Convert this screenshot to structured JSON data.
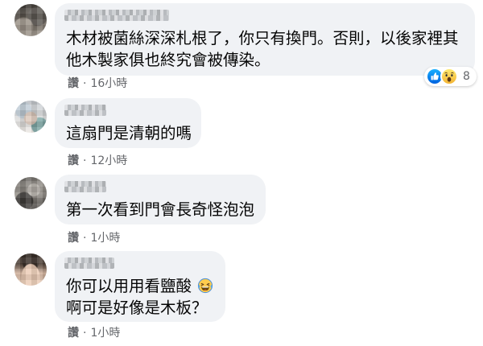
{
  "colors": {
    "page_background": "#ffffff",
    "bubble_background": "#f0f2f5",
    "text_primary": "#050505",
    "text_secondary": "#65676b",
    "like_blue": "#1877f2",
    "wow_yellow": "#f7c94f"
  },
  "comments": [
    {
      "text_lines": [
        "木材被菌絲深深札根了，你只有換門。否則，以後家裡其",
        "他木製家俱也終究會被傳染。"
      ],
      "actions": {
        "like": "讚",
        "separator": "·",
        "time": "16小時"
      },
      "reactions": {
        "icons": [
          "like-reaction-icon",
          "wow-reaction-icon"
        ],
        "count": 8
      }
    },
    {
      "text_lines": [
        "這扇門是清朝的嗎"
      ],
      "actions": {
        "like": "讚",
        "separator": "·",
        "time": "12小時"
      }
    },
    {
      "text_lines": [
        "第一次看到門會長奇怪泡泡"
      ],
      "actions": {
        "like": "讚",
        "separator": "·",
        "time": "1小時"
      }
    },
    {
      "text_lines": [
        "你可以用用看鹽酸",
        "啊可是好像是木板？"
      ],
      "inline_emoji": "laughing-emoji-icon",
      "actions": {
        "like": "讚",
        "separator": "·",
        "time": "1小時"
      }
    }
  ]
}
